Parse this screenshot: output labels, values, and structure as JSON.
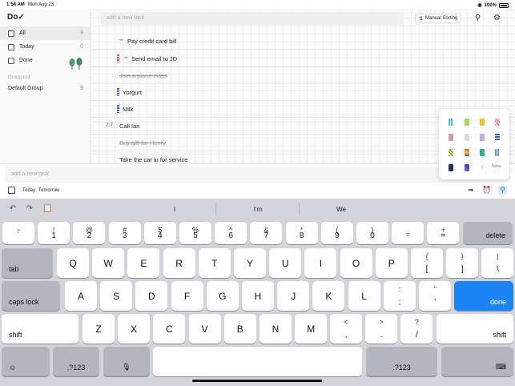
{
  "status": {
    "time": "1:54 AM",
    "date": "Mon Aug 23",
    "battery": "100%"
  },
  "sidebar": {
    "logo": "Do✓",
    "items": [
      {
        "label": "All",
        "count": "9",
        "icon": "inbox-icon"
      },
      {
        "label": "Today",
        "count": "0",
        "icon": "calendar-icon"
      },
      {
        "label": "Done",
        "count": "",
        "icon": "checkbox-icon"
      }
    ],
    "group_list_label": "Group List",
    "groups": [
      {
        "label": "Default Group",
        "count": "9"
      }
    ]
  },
  "main": {
    "search_placeholder": "add a new task",
    "sort_label": "Manual Sorting",
    "tasks": [
      {
        "title": "Pay credit card bill",
        "done": false,
        "num": "",
        "mark": "pin"
      },
      {
        "title": "Send email to JD",
        "done": false,
        "num": "",
        "mark": "red-tag"
      },
      {
        "title": "Join a piano class",
        "done": true,
        "num": "",
        "mark": ""
      },
      {
        "title": "Yorgurt",
        "done": false,
        "num": "",
        "mark": "blue-tag"
      },
      {
        "title": "Milk",
        "done": false,
        "num": "",
        "mark": "blue-tag"
      },
      {
        "title": "Call Ian",
        "done": false,
        "num": "7.7",
        "mark": ""
      },
      {
        "title": "Buy gift for Henry",
        "done": true,
        "num": "",
        "mark": ""
      },
      {
        "title": "Take the car in for service",
        "done": false,
        "num": "",
        "mark": ""
      }
    ]
  },
  "picker": {
    "none_label": "None"
  },
  "addbar": {
    "placeholder": "add a new task",
    "today_label": "Today",
    "tomorrow_label": "Tomorrow"
  },
  "keyboard": {
    "suggestions": [
      "I",
      "I'm",
      "We"
    ],
    "accent_color": "#1d84f5",
    "labels": {
      "delete": "delete",
      "tab": "tab",
      "caps": "caps lock",
      "done": "done",
      "shift": "shift",
      "num_left": ".?123",
      "num_right": ".?123"
    },
    "row1": [
      {
        "t": "~",
        "b": "`"
      },
      {
        "t": "!",
        "b": "1"
      },
      {
        "t": "@",
        "b": "2"
      },
      {
        "t": "#",
        "b": "3"
      },
      {
        "t": "$",
        "b": "4"
      },
      {
        "t": "%",
        "b": "5"
      },
      {
        "t": "^",
        "b": "6"
      },
      {
        "t": "&",
        "b": "7"
      },
      {
        "t": "*",
        "b": "8"
      },
      {
        "t": "(",
        "b": "9"
      },
      {
        "t": ")",
        "b": "0"
      },
      {
        "t": "_",
        "b": "-"
      },
      {
        "t": "+",
        "b": "="
      }
    ],
    "row2": [
      "Q",
      "W",
      "E",
      "R",
      "T",
      "Y",
      "U",
      "I",
      "O",
      "P"
    ],
    "row2_extra": [
      {
        "t": "{",
        "b": "["
      },
      {
        "t": "}",
        "b": "]"
      },
      {
        "t": "|",
        "b": "\\"
      }
    ],
    "row3": [
      "A",
      "S",
      "D",
      "F",
      "G",
      "H",
      "J",
      "K",
      "L"
    ],
    "row3_extra": [
      {
        "t": ":",
        "b": ";"
      },
      {
        "t": "”",
        "b": "'"
      }
    ],
    "row4": [
      "Z",
      "X",
      "C",
      "V",
      "B",
      "N",
      "M"
    ],
    "row4_extra": [
      {
        "t": "<",
        "b": ","
      },
      {
        "t": ">",
        "b": "."
      },
      {
        "t": "?",
        "b": "/"
      }
    ]
  }
}
